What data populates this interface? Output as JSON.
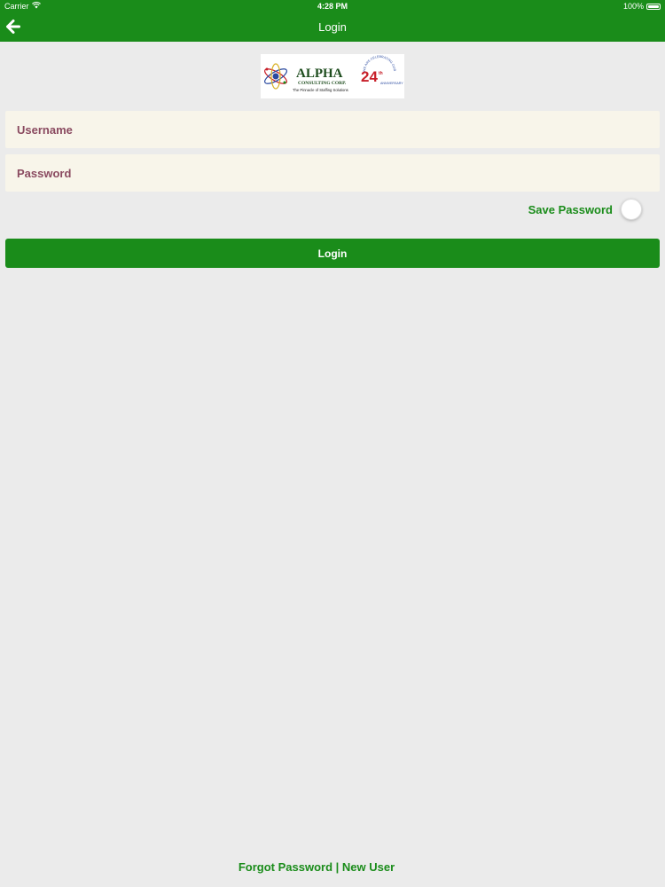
{
  "status_bar": {
    "carrier": "Carrier",
    "time": "4:28 PM",
    "battery": "100%",
    "battery_level": 1.0
  },
  "nav": {
    "title": "Login",
    "back_icon": "arrow-left-icon"
  },
  "logo": {
    "brand": "ALPHA",
    "company": "CONSULTING CORP.",
    "tagline": "The Pinnacle of Staffing Solutions",
    "anniversary_text": "WE ARE CELEBRATING OUR",
    "anniversary_number": "24",
    "anniversary_suffix": "th",
    "anniversary_label": "ANNIVERSARY"
  },
  "form": {
    "username_placeholder": "Username",
    "username_value": "",
    "password_placeholder": "Password",
    "password_value": "",
    "save_password_label": "Save Password",
    "save_password_on": false,
    "login_label": "Login"
  },
  "footer": {
    "forgot_password": "Forgot Password",
    "separator": " | ",
    "new_user": "New User"
  },
  "colors": {
    "primary_green": "#1a8c1a",
    "background": "#ebebeb",
    "input_background": "#f8f5ea",
    "placeholder": "#8a4a60",
    "logo_red": "#c8202a",
    "logo_blue": "#2a4aa0"
  }
}
